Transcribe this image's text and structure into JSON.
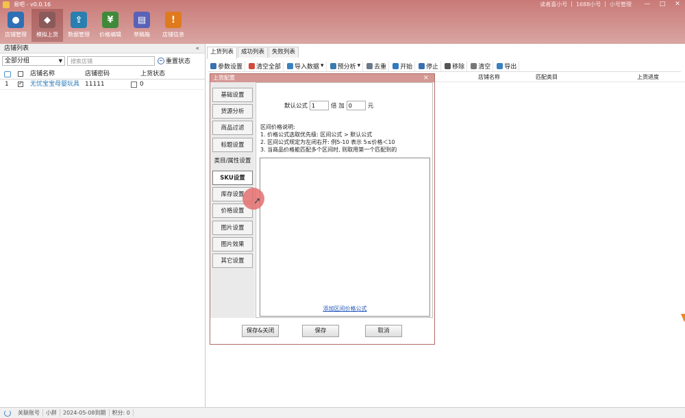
{
  "app": {
    "title": "易吧 - v0.0.16",
    "user_items": [
      "读者喜小号",
      "1688小号",
      "小号管理"
    ],
    "window_controls": [
      "—",
      "□",
      "✕"
    ]
  },
  "toolbar": [
    {
      "id": "shop-manage",
      "label": "店铺管理",
      "color": "#2f6fb3",
      "icon": "person-icon"
    },
    {
      "id": "simulate-upload",
      "label": "模拟上货",
      "color": "#8a5a5a",
      "icon": "spy-icon",
      "active": true
    },
    {
      "id": "data-manage",
      "label": "数据管理",
      "color": "#2a7fb0",
      "icon": "upload-tray-icon"
    },
    {
      "id": "price-edit",
      "label": "价格编辑",
      "color": "#3f8a3a",
      "icon": "price-tag-icon"
    },
    {
      "id": "draft-box",
      "label": "草稿箱",
      "color": "#5a62b8",
      "icon": "draft-icon"
    },
    {
      "id": "shop-info",
      "label": "店铺信息",
      "color": "#e07a1e",
      "icon": "info-icon"
    }
  ],
  "left_panel": {
    "header": "店铺列表",
    "collapse": "«",
    "group_select": "全部分组",
    "search_placeholder": "搜索店铺",
    "reset_label": "重置状态",
    "columns": [
      "店铺名称",
      "店铺密码",
      "上货状态"
    ],
    "rows": [
      {
        "index": "1",
        "name": "无忧宝宝母婴玩具",
        "password": "11111",
        "status": "0"
      }
    ]
  },
  "right_panel": {
    "tabs": [
      "上货列表",
      "成功列表",
      "失败列表"
    ],
    "toolbar": [
      {
        "label": "参数设置",
        "color": "#3a6fb0"
      },
      {
        "label": "清空全部",
        "color": "#d24a3a"
      },
      {
        "label": "导入数据",
        "color": "#3a80c0",
        "dropdown": true
      },
      {
        "label": "预分析",
        "color": "#3a7ab0",
        "dropdown": true
      },
      {
        "label": "去重",
        "color": "#6a7a8a"
      },
      {
        "label": "开始",
        "color": "#2f7ac0"
      },
      {
        "label": "停止",
        "color": "#3a6fb0"
      },
      {
        "label": "移除",
        "color": "#555555"
      },
      {
        "label": "清空",
        "color": "#777777"
      },
      {
        "label": "导出",
        "color": "#3a80c0"
      }
    ],
    "columns": [
      "店铺名称",
      "匹配类目",
      "上货进度"
    ]
  },
  "dialog": {
    "title": "上货配置",
    "close": "×",
    "nav_items": [
      "基础设置",
      "货源分析",
      "商品过滤",
      "标题设置",
      "类目/属性设置",
      "SKU设置",
      "库存设置",
      "价格设置",
      "图片设置",
      "图片效果",
      "其它设置"
    ],
    "active_nav": "SKU设置",
    "default_formula_label": "默认公式",
    "multiplier": "1",
    "times_add": "倍 加",
    "addend": "0",
    "unit": "元",
    "explanation": [
      "区间价格说明:",
      "1. 价格公式选取优先级: 区间公式 > 默认公式",
      "2. 区间公式规定为左闭右开: 例5-10 表示 5≤价格＜10",
      "3. 当商品价格能匹配多个区间时, 则取用第一个匹配到的"
    ],
    "add_link": "添加区间价格公式",
    "buttons": [
      "保存&关闭",
      "保存",
      "取消"
    ]
  },
  "status_bar": [
    "关联账号",
    "小胖",
    "2024-05-08到期",
    "积分: 0"
  ]
}
